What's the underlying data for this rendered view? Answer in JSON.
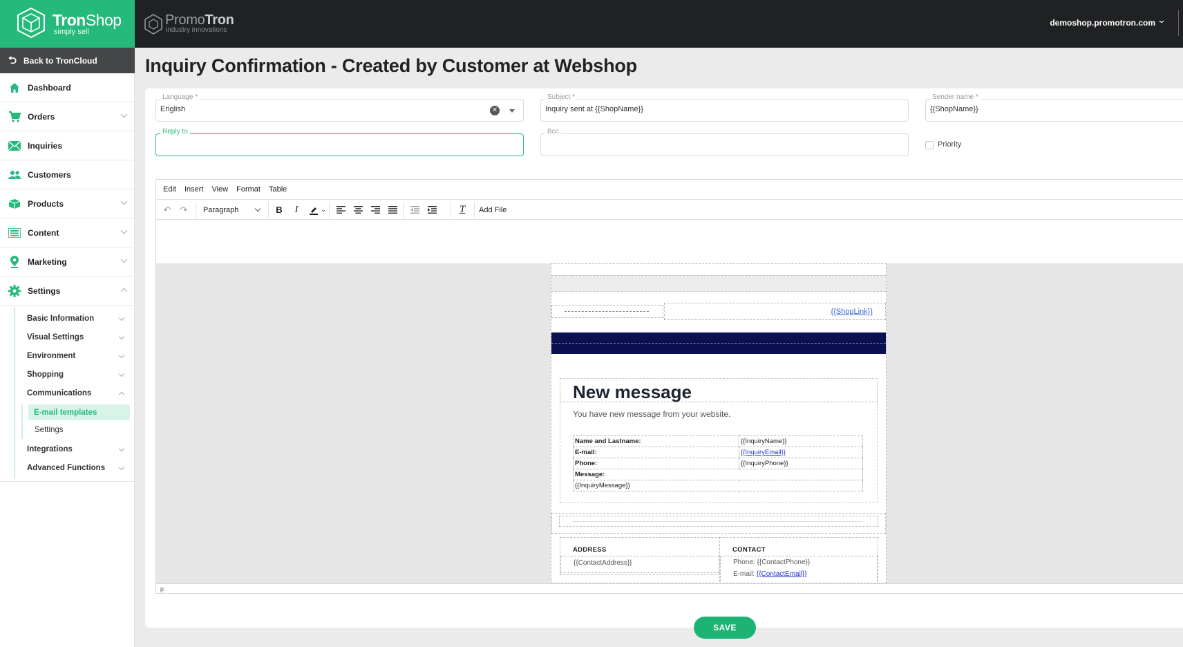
{
  "brand": {
    "name_bold": "Tron",
    "name_rest": "Shop",
    "tagline": "simply sell",
    "color": "#25b97c"
  },
  "topbar": {
    "partner_light": "Promo",
    "partner_bold": "Tron",
    "partner_tagline": "industry innovations",
    "domain": "demoshop.promotron.com"
  },
  "sidebar": {
    "back_label": "Back to TronCloud",
    "items": [
      {
        "label": "Dashboard",
        "icon": "home-icon"
      },
      {
        "label": "Orders",
        "icon": "cart-icon"
      },
      {
        "label": "Inquiries",
        "icon": "mail-icon"
      },
      {
        "label": "Customers",
        "icon": "people-icon"
      },
      {
        "label": "Products",
        "icon": "box-icon"
      },
      {
        "label": "Content",
        "icon": "list-icon"
      },
      {
        "label": "Marketing",
        "icon": "pin-icon"
      },
      {
        "label": "Settings",
        "icon": "gear-icon"
      }
    ],
    "settings_sub": [
      "Basic Information",
      "Visual Settings",
      "Environment",
      "Shopping",
      "Communications",
      "Integrations",
      "Advanced Functions"
    ],
    "communications_sub": [
      "E-mail templates",
      "Settings"
    ]
  },
  "page": {
    "title": "Inquiry Confirmation - Created by Customer at Webshop"
  },
  "form": {
    "language": {
      "label": "Language *",
      "value": "English"
    },
    "subject": {
      "label": "Subject *",
      "value": "Inquiry sent at {{ShopName}}"
    },
    "sender": {
      "label": "Sender name *",
      "value": "{{ShopName}}"
    },
    "reply_to": {
      "label": "Reply to",
      "value": ""
    },
    "bcc": {
      "label": "Bcc",
      "value": ""
    },
    "priority": {
      "label": "Priority",
      "checked": false
    }
  },
  "editor": {
    "menu": [
      "Edit",
      "Insert",
      "View",
      "Format",
      "Table"
    ],
    "block_format": "Paragraph",
    "add_file": "Add File",
    "status_path": "p"
  },
  "email": {
    "shop_link": "{{ShopLink}}",
    "title": "New message",
    "subtitle": "You have new message from your website.",
    "rows": [
      {
        "key": "Name and Lastname:",
        "value": "{{InquiryName}}",
        "link": false
      },
      {
        "key": "E-mail:",
        "value": "{{InquiryEmail}}",
        "link": true
      },
      {
        "key": "Phone:",
        "value": "{{InquiryPhone}}",
        "link": false
      }
    ],
    "message_label": "Message:",
    "message_value": "{{InquiryMessage}}",
    "address_heading": "ADDRESS",
    "address_value": "{{ContactAddress}}",
    "contact_heading": "CONTACT",
    "contact_phone_prefix": "Phone: ",
    "contact_phone": "{{ContactPhone}}",
    "contact_email_prefix": "E-mail: ",
    "contact_email": "{{ContactEmail}}",
    "header_color": "#0b1050"
  },
  "actions": {
    "save_label": "SAVE"
  }
}
